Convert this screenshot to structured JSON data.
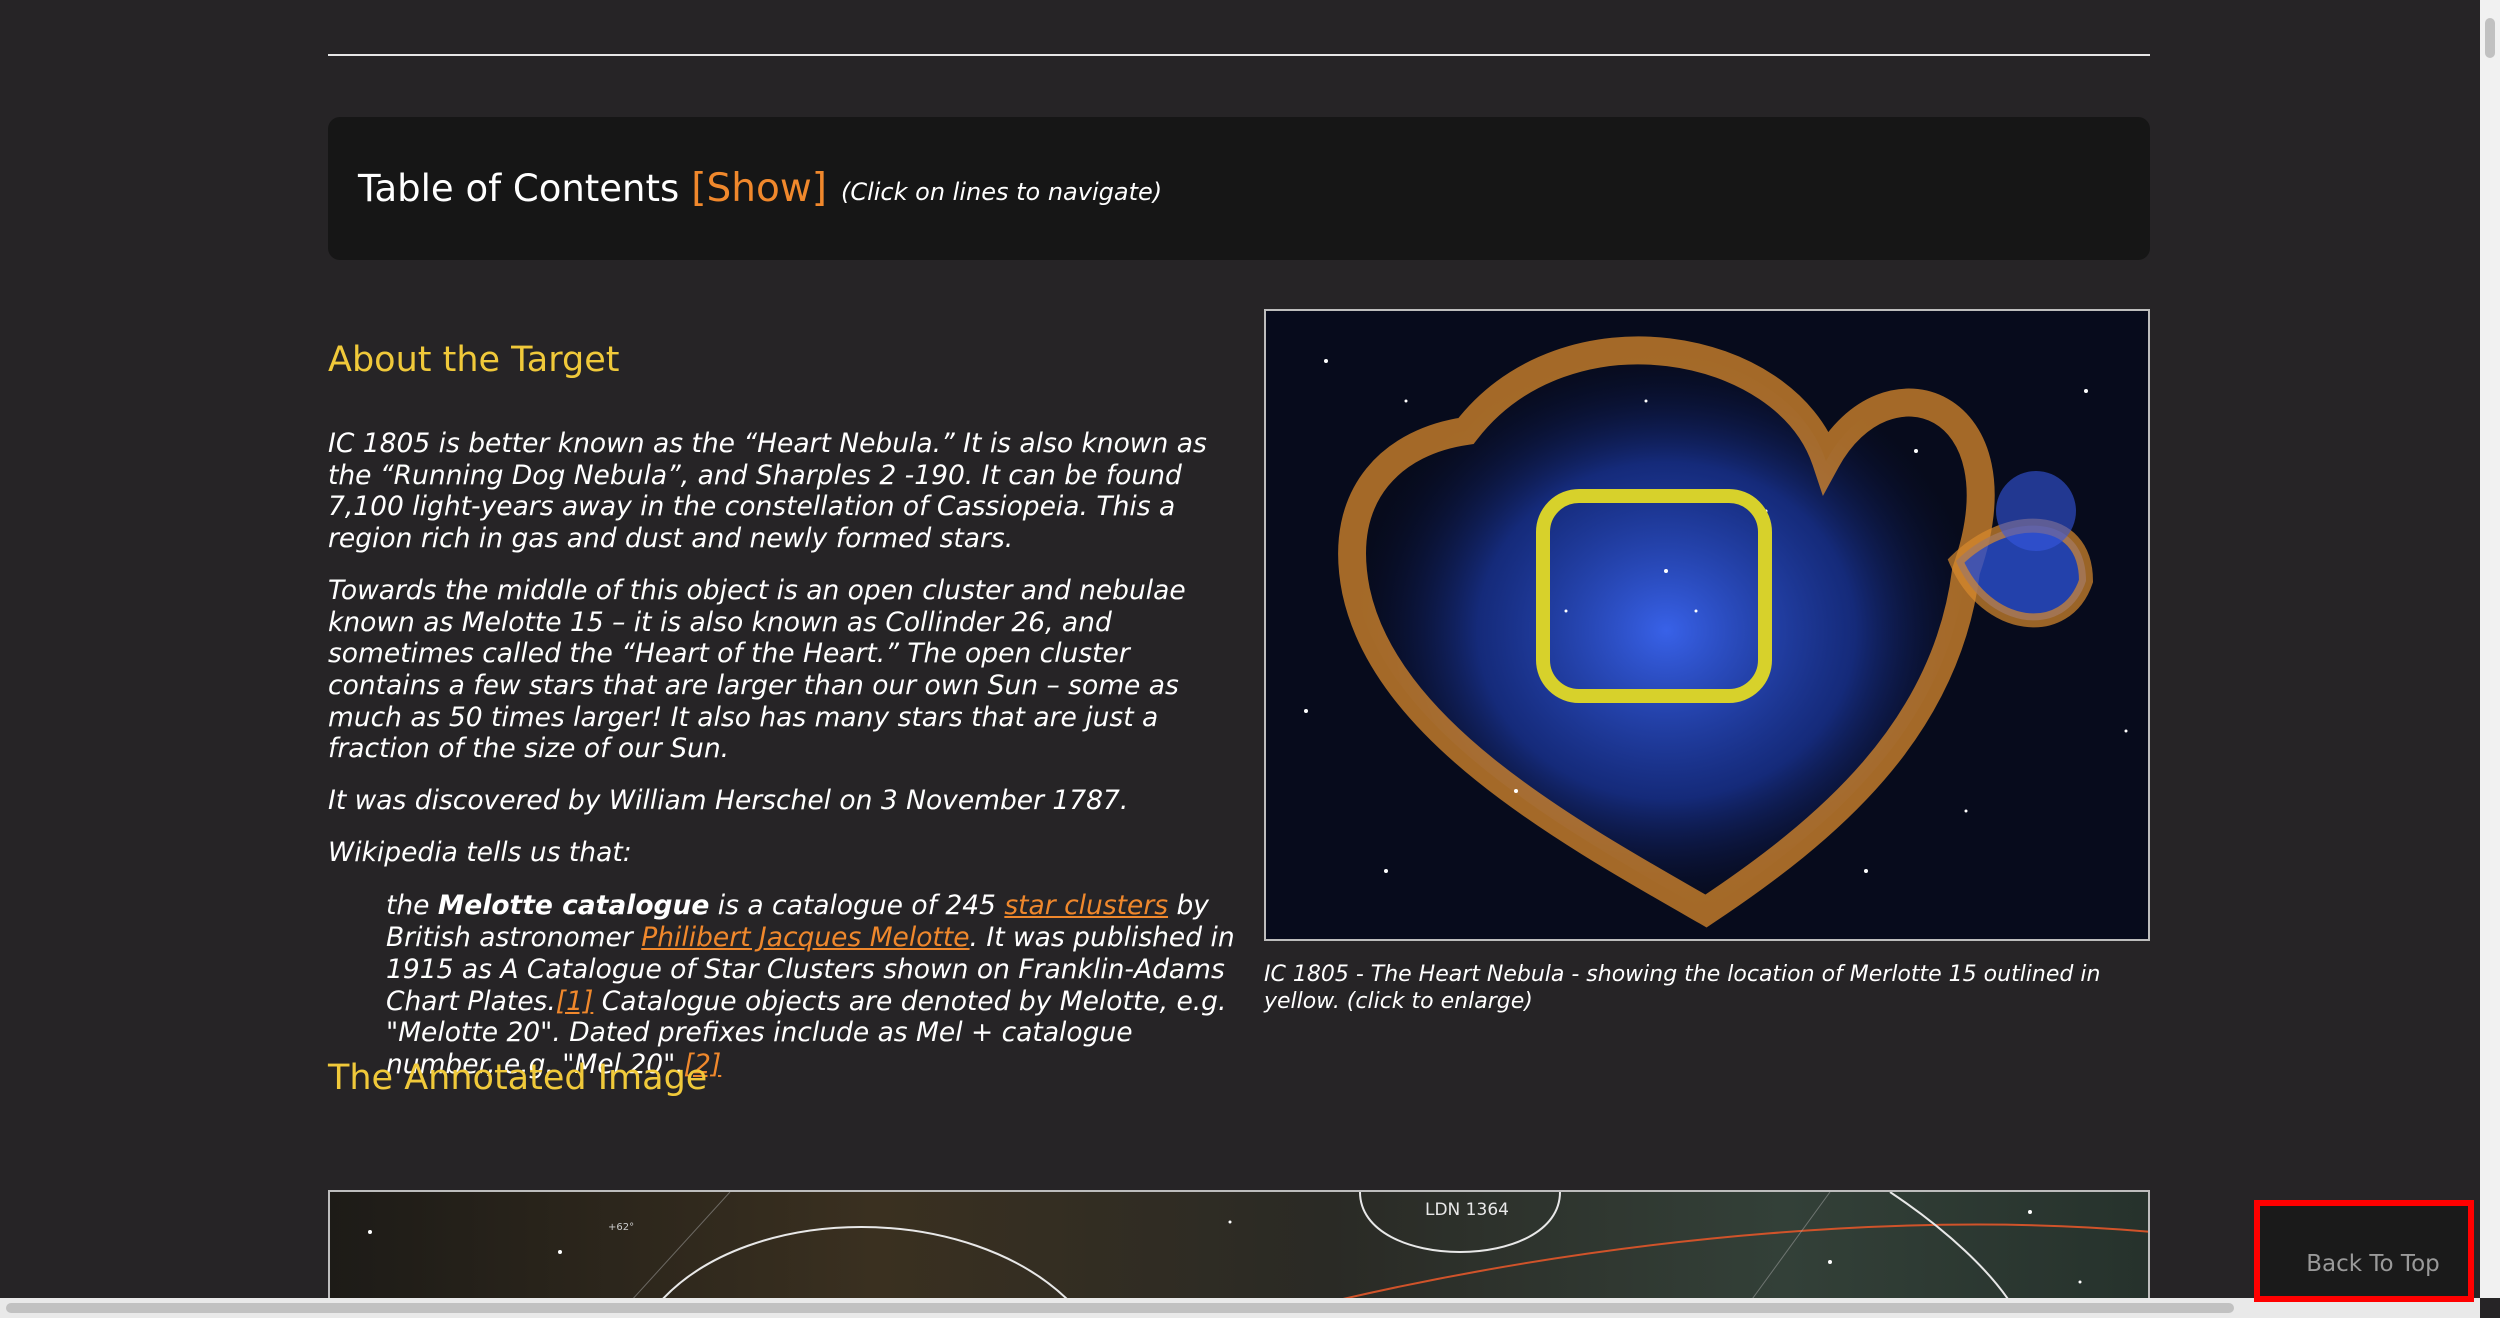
{
  "toc": {
    "title": "Table of Contents",
    "toggle": "[Show]",
    "hint": "(Click on lines to navigate)"
  },
  "about": {
    "heading": "About the Target",
    "p1": "IC 1805 is better known as the “Heart Nebula.” It is also known as the “Running Dog Nebula”,  and Sharples 2 -190. It can be found 7,100 light-years away in the constellation of Cassiopeia.  This a region rich in gas and dust and newly formed stars.",
    "p2": "Towards the middle of this object is an open cluster and nebulae known as Melotte 15  – it is also known as Collinder 26, and sometimes called the “Heart of the Heart.” The open cluster contains a few stars that are larger than our own Sun – some as much as 50 times larger! It also has many stars that are just a fraction of the size of our Sun.",
    "p3": "It was discovered by William Herschel on 3 November 1787.",
    "p4": "Wikipedia tells us that:",
    "quote": {
      "pre": "the ",
      "bold": "Melotte catalogue",
      "mid1": " is a catalogue of 245 ",
      "link1": "star clusters",
      "mid2": " by British astronomer ",
      "link2": "Philibert Jacques Melotte",
      "mid3": ". It was published in 1915 as A Catalogue of Star Clusters shown on Franklin-Adams Chart Plates.",
      "ref1": "[1]",
      "mid4": " Catalogue objects are denoted by Melotte, e.g. \"Melotte 20\". Dated prefixes include as Mel + catalogue number, e.g. \"Mel 20\".",
      "ref2": "[2]"
    }
  },
  "figure": {
    "caption": "IC 1805 - The Heart Nebula - showing the location of Merlotte 15 outlined in yellow. (click to enlarge)"
  },
  "annotated": {
    "heading": "The Annotated Image",
    "label_ldn": "LDN 1364",
    "label_small": "+62°"
  },
  "back_to_top": "Back To Top",
  "colors": {
    "background": "#262426",
    "heading": "#f0c93a",
    "link": "#f0882c",
    "highlight_box": "#ff0000"
  }
}
